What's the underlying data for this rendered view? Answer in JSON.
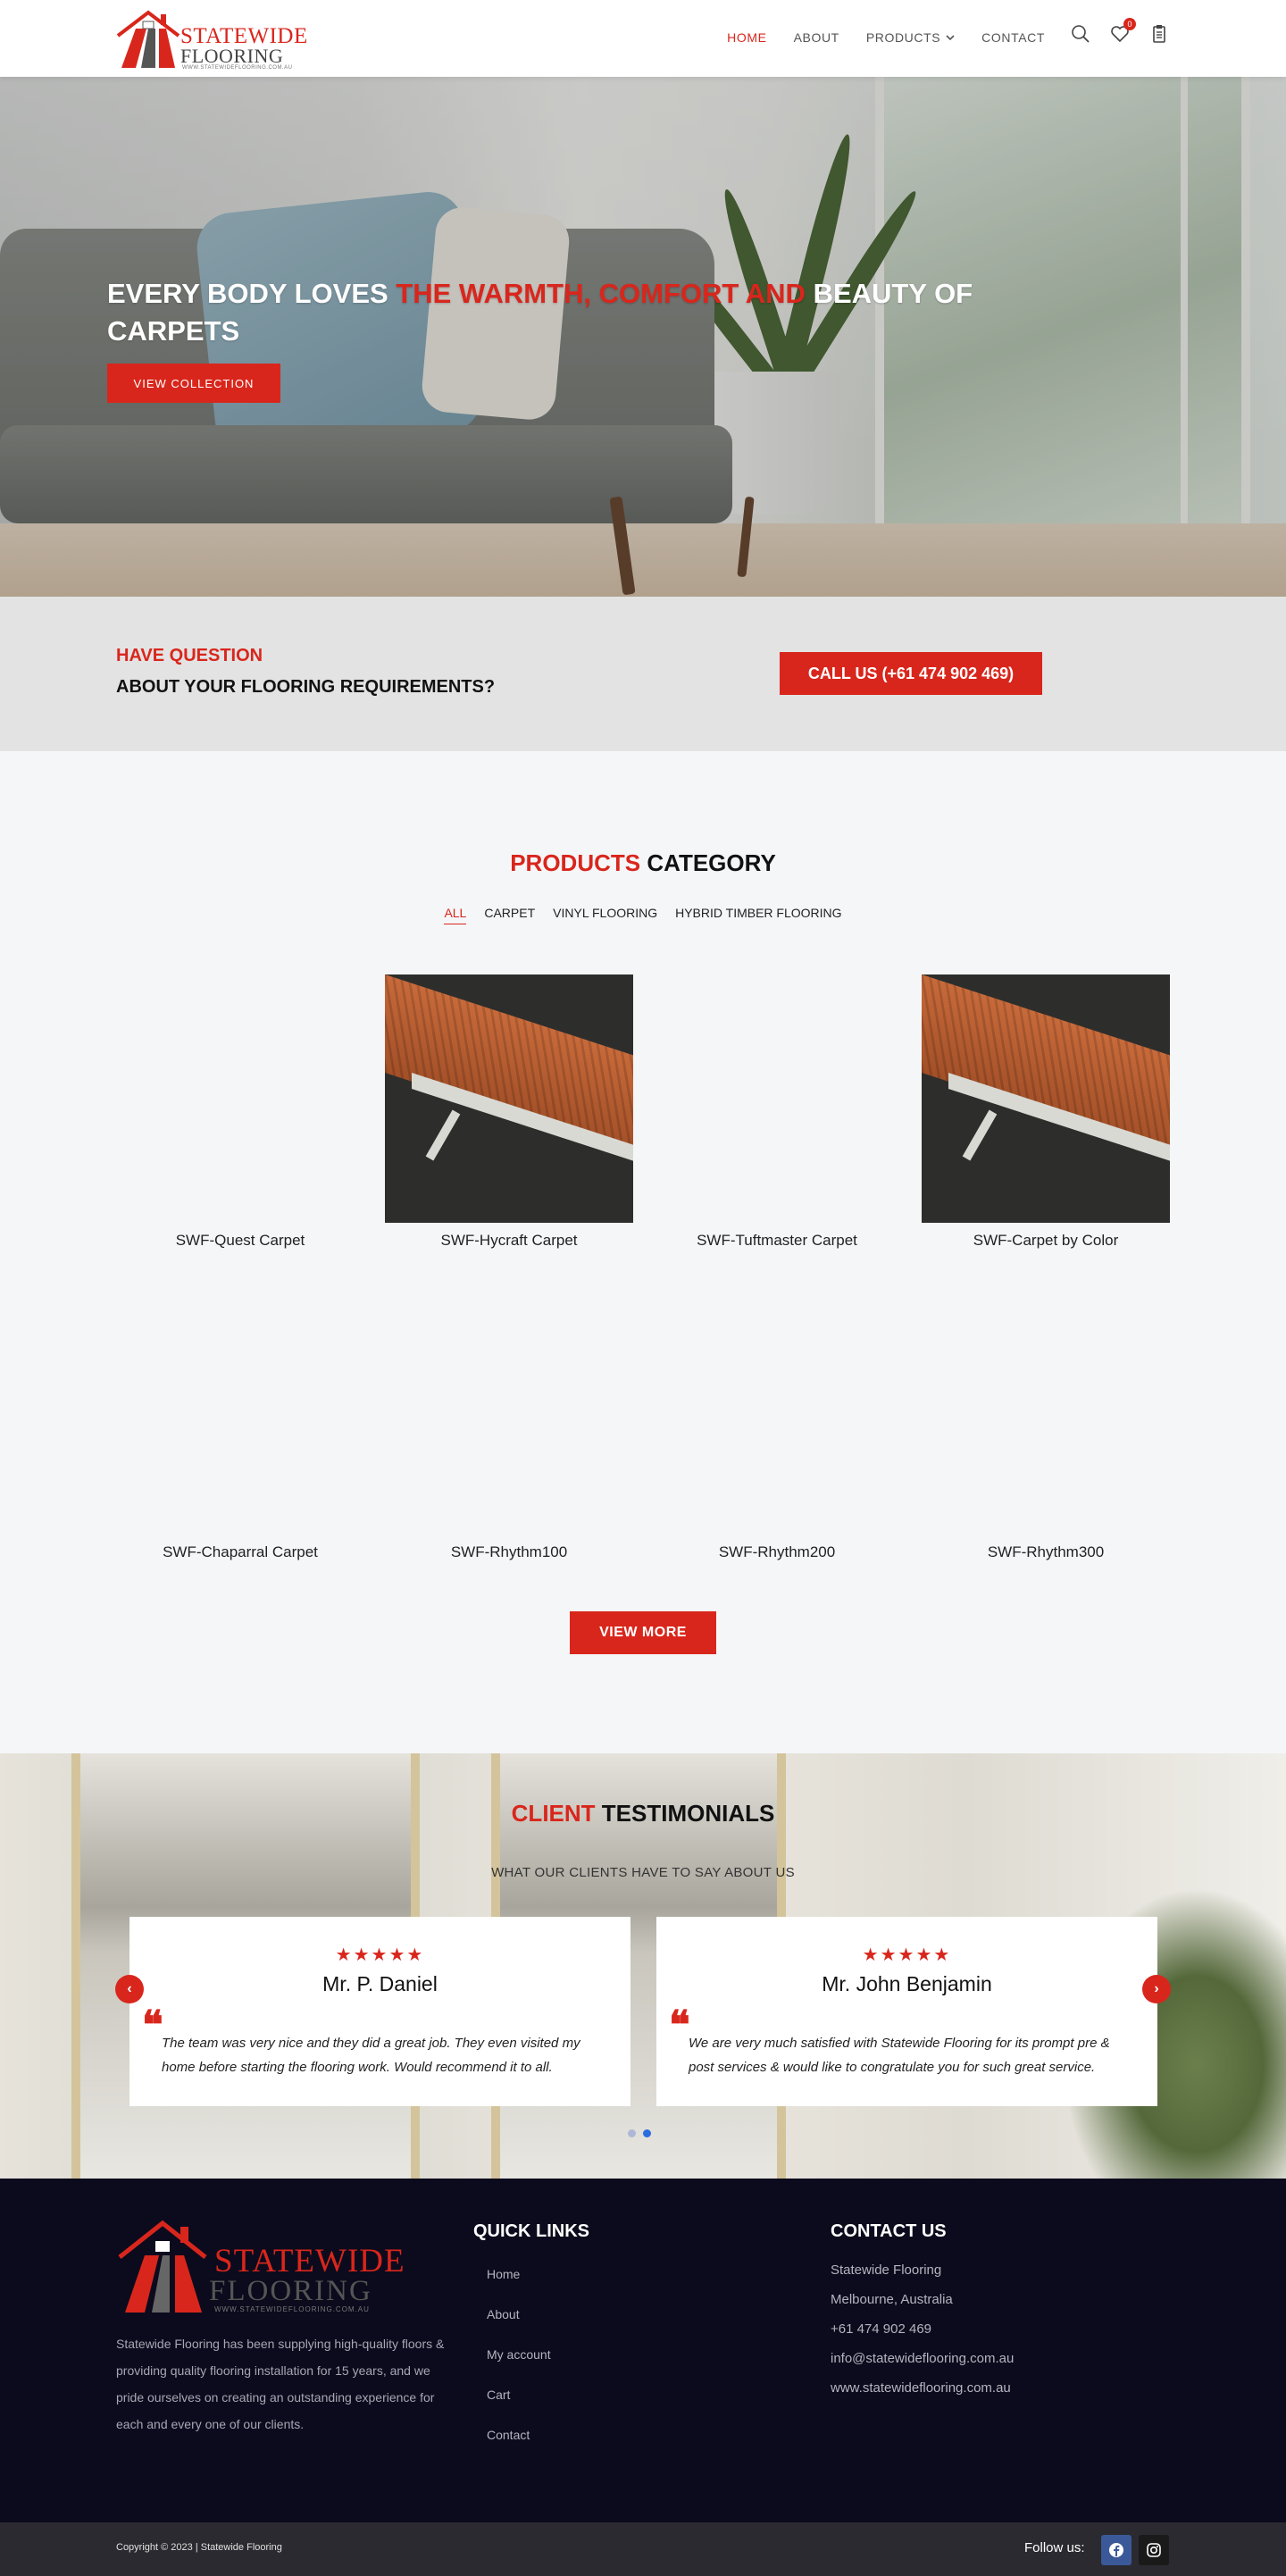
{
  "header": {
    "logo_line1": "STATEWIDE",
    "logo_line2": "FLOORING",
    "logo_url": "WWW.STATEWIDEFLOORING.COM.AU",
    "nav": [
      {
        "label": "HOME",
        "active": true
      },
      {
        "label": "ABOUT",
        "active": false
      },
      {
        "label": "PRODUCTS",
        "active": false
      },
      {
        "label": "CONTACT",
        "active": false
      }
    ],
    "wishlist_count": "0"
  },
  "hero": {
    "title_part1": "EVERY BODY LOVES ",
    "title_part2": "THE WARMTH, COMFORT AND",
    "title_part3": " BEAUTY OF CARPETS",
    "button_label": "VIEW COLLECTION"
  },
  "question": {
    "line1": "HAVE QUESTION",
    "line2": "ABOUT YOUR FLOORING REQUIREMENTS?",
    "call_label": "CALL US (+61 474 902 469)"
  },
  "products": {
    "title_red": "PRODUCTS",
    "title_dark": " CATEGORY",
    "filters": [
      {
        "label": "ALL",
        "active": true
      },
      {
        "label": "CARPET",
        "active": false
      },
      {
        "label": "VINYL FLOORING",
        "active": false
      },
      {
        "label": "HYBRID TIMBER FLOORING",
        "active": false
      }
    ],
    "items": [
      {
        "name": "SWF-Quest Carpet",
        "image": false
      },
      {
        "name": "SWF-Hycraft Carpet",
        "image": true
      },
      {
        "name": "SWF-Tuftmaster Carpet",
        "image": false
      },
      {
        "name": "SWF-Carpet by Color",
        "image": true
      },
      {
        "name": "SWF-Chaparral Carpet",
        "image": false
      },
      {
        "name": "SWF-Rhythm100",
        "image": false
      },
      {
        "name": "SWF-Rhythm200",
        "image": false
      },
      {
        "name": "SWF-Rhythm300",
        "image": false
      }
    ],
    "view_more": "VIEW MORE"
  },
  "testimonials": {
    "title_red": "CLIENT",
    "title_dark": " TESTIMONIALS",
    "subtitle": "WHAT OUR CLIENTS HAVE TO SAY ABOUT US",
    "stars": "★★★★★",
    "quote_mark": "❝",
    "cards": [
      {
        "name": "Mr. P. Daniel",
        "rating": 5,
        "text": "The team was very nice and they did a great job. They even visited my home before starting the flooring work. Would recommend it to all."
      },
      {
        "name": "Mr. John Benjamin",
        "rating": 5,
        "text": "We are very much satisfied with Statewide Flooring for its prompt pre & post services & would like to congratulate you for such great service."
      }
    ],
    "prev_arrow": "‹",
    "next_arrow": "›",
    "active_dot": 1
  },
  "footer": {
    "logo_line1": "STATEWIDE",
    "logo_line2": "FLOORING",
    "logo_url": "WWW.STATEWIDEFLOORING.COM.AU",
    "about": "Statewide Flooring has been supplying high-quality floors & providing quality flooring installation for 15 years, and we pride ourselves on creating an outstanding experience for each and every one of our clients.",
    "quick_links_title": "QUICK LINKS",
    "quick_links": [
      "Home",
      "About",
      "My account",
      "Cart",
      "Contact"
    ],
    "contact_title": "CONTACT US",
    "contact": [
      "Statewide Flooring",
      "Melbourne, Australia",
      "+61 474 902 469",
      "info@statewideflooring.com.au",
      "www.statewideflooring.com.au"
    ],
    "copyright": "Copyright © 2023 | Statewide Flooring",
    "follow_label": "Follow us:",
    "social": [
      "facebook-icon",
      "instagram-icon"
    ]
  },
  "colors": {
    "accent": "#d9261c",
    "footer_bg": "#0c0b1d",
    "facebook": "#3b5998"
  }
}
